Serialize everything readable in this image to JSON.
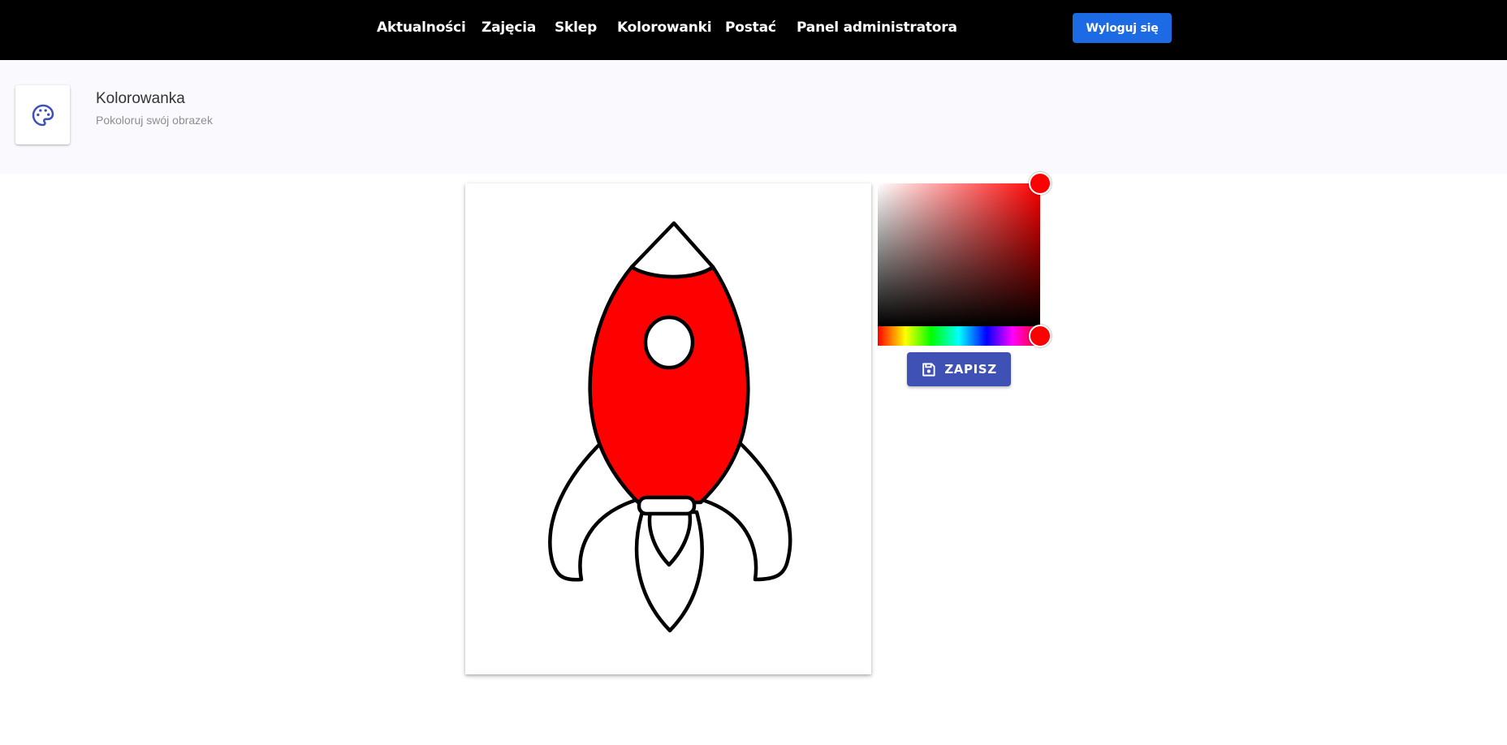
{
  "nav": {
    "items": [
      {
        "label": "Aktualności"
      },
      {
        "label": "Zajęcia"
      },
      {
        "label": "Sklep"
      },
      {
        "label": "Kolorowanki"
      },
      {
        "label": "Postać"
      },
      {
        "label": "Panel administratora"
      }
    ],
    "logout_label": "Wyloguj się"
  },
  "header": {
    "icon": "palette-icon",
    "title": "Kolorowanka",
    "subtitle": "Pokoloruj swój obrazek"
  },
  "color_picker": {
    "selected_color": "#ff0000",
    "hue_color": "#ff0000"
  },
  "save": {
    "label": "ZAPISZ",
    "icon": "save-icon"
  },
  "drawing": {
    "subject": "rocket",
    "fill_color": "#ff0000",
    "stroke_color": "#000000"
  },
  "colors": {
    "topbar": "#000000",
    "logout_button": "#1d6ae5",
    "save_button": "#3f51b5",
    "header_band": "#fafafe",
    "icon_accent": "#3f51b5"
  }
}
